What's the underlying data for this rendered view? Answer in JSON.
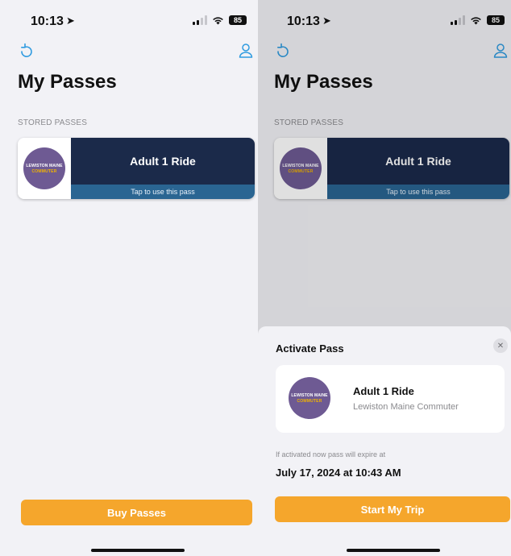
{
  "colors": {
    "accent": "#2f9be0",
    "primary_button": "#f5a62c",
    "pass_dark": "#1b2a4a",
    "pass_bar": "#2a6592",
    "logo_purple": "#6e5a93",
    "logo_yellow": "#f2b400"
  },
  "status_bar": {
    "time": "10:13",
    "location_icon": "navigation-arrow-icon",
    "battery": "85"
  },
  "header": {
    "refresh_icon": "refresh-icon",
    "profile_icon": "person-icon",
    "title": "My Passes"
  },
  "stored_passes": {
    "section_label": "STORED PASSES",
    "items": [
      {
        "name": "Adult 1 Ride",
        "action_text": "Tap to use this pass",
        "logo_line1": "LEWISTON MAINE",
        "logo_line2": "COMMUTER"
      }
    ]
  },
  "footer": {
    "buy_button_label": "Buy Passes"
  },
  "activate_sheet": {
    "title": "Activate Pass",
    "close_icon": "close-icon",
    "pass_name": "Adult 1 Ride",
    "agency": "Lewiston Maine Commuter",
    "expire_note": "If activated now pass will expire at",
    "expire_datetime": "July 17, 2024 at 10:43 AM",
    "start_button_label": "Start My Trip"
  }
}
